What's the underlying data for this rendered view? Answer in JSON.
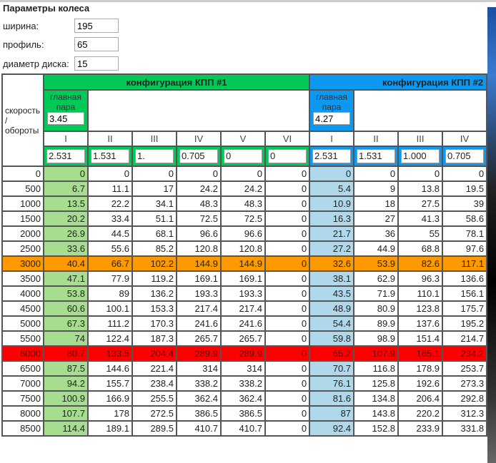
{
  "title": "Параметры колеса",
  "params": [
    {
      "label": "ширина:",
      "value": "195"
    },
    {
      "label": "профиль:",
      "value": "65"
    },
    {
      "label": "диаметр диска:",
      "value": "15"
    }
  ],
  "row_label": "скорость / обороты",
  "config1": {
    "title": "конфигурация КПП #1",
    "main_label": "главная пара",
    "main_value": "3.45",
    "gears": [
      "I",
      "II",
      "III",
      "IV",
      "V",
      "VI"
    ],
    "ratios": [
      "2.531",
      "1.531",
      "1.",
      "0.705",
      "0",
      "0"
    ],
    "color": "#00c957"
  },
  "config2": {
    "title": "конфигурация КПП #2",
    "main_label": "главная пара",
    "main_value": "4.27",
    "gears": [
      "I",
      "II",
      "III",
      "IV"
    ],
    "ratios": [
      "2.531",
      "1.531",
      "1.000",
      "0.705"
    ],
    "color": "#0d99f2"
  },
  "rows": [
    [
      "0",
      "0",
      "0",
      "0",
      "0",
      "0",
      "0",
      "0",
      "0",
      "0",
      "0"
    ],
    [
      "500",
      "6.7",
      "11.1",
      "17",
      "24.2",
      "24.2",
      "0",
      "5.4",
      "9",
      "13.8",
      "19.5"
    ],
    [
      "1000",
      "13.5",
      "22.2",
      "34.1",
      "48.3",
      "48.3",
      "0",
      "10.9",
      "18",
      "27.5",
      "39"
    ],
    [
      "1500",
      "20.2",
      "33.4",
      "51.1",
      "72.5",
      "72.5",
      "0",
      "16.3",
      "27",
      "41.3",
      "58.6"
    ],
    [
      "2000",
      "26.9",
      "44.5",
      "68.1",
      "96.6",
      "96.6",
      "0",
      "21.7",
      "36",
      "55",
      "78.1"
    ],
    [
      "2500",
      "33.6",
      "55.6",
      "85.2",
      "120.8",
      "120.8",
      "0",
      "27.2",
      "44.9",
      "68.8",
      "97.6"
    ],
    [
      "3000",
      "40.4",
      "66.7",
      "102.2",
      "144.9",
      "144.9",
      "0",
      "32.6",
      "53.9",
      "82.6",
      "117.1"
    ],
    [
      "3500",
      "47.1",
      "77.9",
      "119.2",
      "169.1",
      "169.1",
      "0",
      "38.1",
      "62.9",
      "96.3",
      "136.6"
    ],
    [
      "4000",
      "53.8",
      "89",
      "136.2",
      "193.3",
      "193.3",
      "0",
      "43.5",
      "71.9",
      "110.1",
      "156.1"
    ],
    [
      "4500",
      "60.6",
      "100.1",
      "153.3",
      "217.4",
      "217.4",
      "0",
      "48.9",
      "80.9",
      "123.8",
      "175.7"
    ],
    [
      "5000",
      "67.3",
      "111.2",
      "170.3",
      "241.6",
      "241.6",
      "0",
      "54.4",
      "89.9",
      "137.6",
      "195.2"
    ],
    [
      "5500",
      "74",
      "122.4",
      "187.3",
      "265.7",
      "265.7",
      "0",
      "59.8",
      "98.9",
      "151.4",
      "214.7"
    ],
    [
      "6000",
      "80.7",
      "133.5",
      "204.4",
      "289.9",
      "289.9",
      "0",
      "65.2",
      "107.9",
      "165.1",
      "234.2"
    ],
    [
      "6500",
      "87.5",
      "144.6",
      "221.4",
      "314",
      "314",
      "0",
      "70.7",
      "116.8",
      "178.9",
      "253.7"
    ],
    [
      "7000",
      "94.2",
      "155.7",
      "238.4",
      "338.2",
      "338.2",
      "0",
      "76.1",
      "125.8",
      "192.6",
      "273.3"
    ],
    [
      "7500",
      "100.9",
      "166.9",
      "255.5",
      "362.4",
      "362.4",
      "0",
      "81.6",
      "134.8",
      "206.4",
      "292.8"
    ],
    [
      "8000",
      "107.7",
      "178",
      "272.5",
      "386.5",
      "386.5",
      "0",
      "87",
      "143.8",
      "220.2",
      "312.3"
    ],
    [
      "8500",
      "114.4",
      "189.1",
      "289.5",
      "410.7",
      "410.7",
      "0",
      "92.4",
      "152.8",
      "233.9",
      "331.8"
    ]
  ],
  "highlight": {
    "3000": "orange",
    "6000": "red"
  }
}
